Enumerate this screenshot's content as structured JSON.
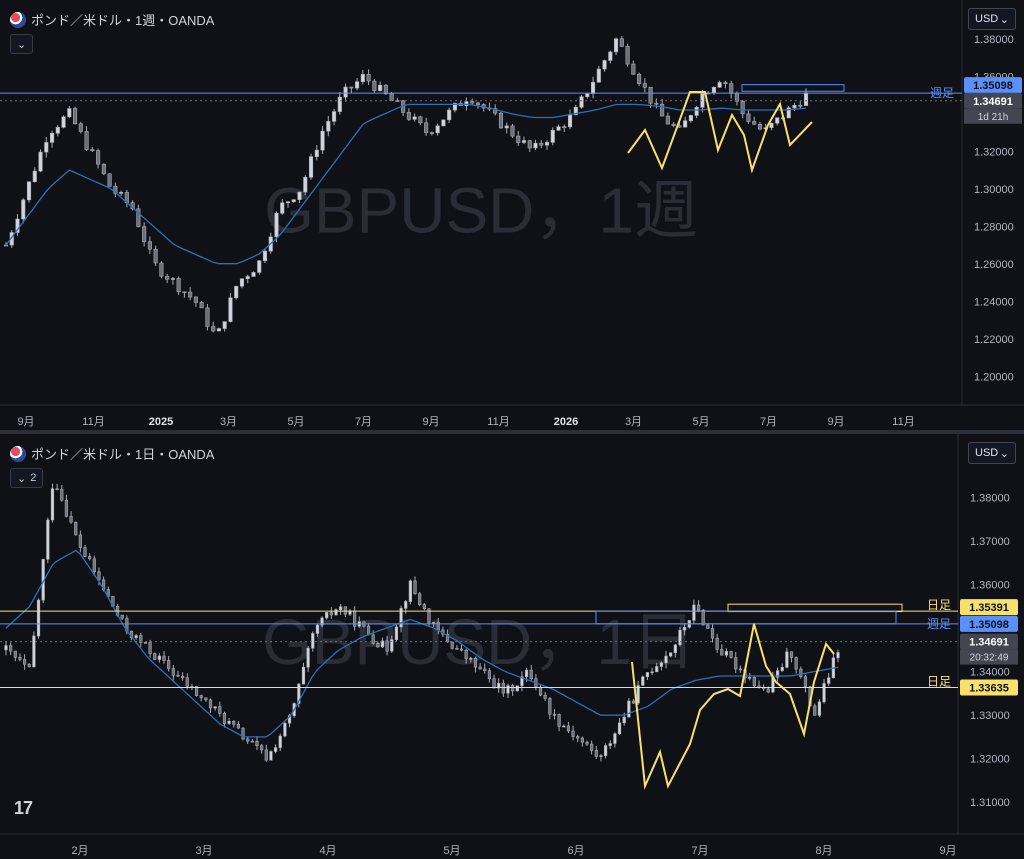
{
  "weekly": {
    "title": "ポンド／米ドル・1週・OANDA",
    "currency": "USD",
    "watermark": "GBPUSD，1週",
    "collapse_label": "",
    "yticks": [
      "1.38000",
      "1.36000",
      "1.34000",
      "1.32000",
      "1.30000",
      "1.28000",
      "1.26000",
      "1.24000",
      "1.22000",
      "1.20000"
    ],
    "xticks": [
      "9月",
      "11月",
      "2025",
      "3月",
      "5月",
      "7月",
      "9月",
      "11月",
      "2026",
      "3月",
      "5月",
      "7月",
      "9月",
      "11月"
    ],
    "level_label": "週足",
    "level_price": "1.35098",
    "last_price": "1.34691",
    "countdown": "1d 21h",
    "colors": {
      "up": "#d1d4dc",
      "down": "#d1d4dc",
      "ma": "#2f6fb3",
      "line": "#5b8ff9",
      "zigzag": "#f7e16b"
    }
  },
  "daily": {
    "title": "ポンド／米ドル・1日・OANDA",
    "currency": "USD",
    "watermark": "GBPUSD，1日",
    "collapse_label": "2",
    "yticks": [
      "1.38000",
      "1.37000",
      "1.36000",
      "1.35000",
      "1.34000",
      "1.33000",
      "1.32000",
      "1.31000"
    ],
    "xticks": [
      "2月",
      "3月",
      "4月",
      "5月",
      "6月",
      "7月",
      "8月",
      "9月"
    ],
    "levels": [
      {
        "label": "日足",
        "price": "1.35391",
        "color": "#f7e16b"
      },
      {
        "label": "週足",
        "price": "1.35098",
        "color": "#5b8ff9"
      },
      {
        "label": "日足",
        "price": "1.33635",
        "color": "#f7e16b"
      }
    ],
    "last_price": "1.34691",
    "countdown": "20:32:49"
  },
  "logo": "17",
  "chart_data": [
    {
      "type": "candlestick",
      "title": "ポンド／米ドル・1週・OANDA",
      "ylim": [
        1.19,
        1.39
      ],
      "x_ticks": [
        "9月",
        "11月",
        "2025",
        "3月",
        "5月",
        "7月",
        "9月",
        "11月",
        "2026",
        "3月",
        "5月",
        "7月",
        "9月",
        "11月"
      ],
      "close_path": [
        1.27,
        1.3,
        1.33,
        1.34,
        1.32,
        1.3,
        1.29,
        1.26,
        1.25,
        1.24,
        1.22,
        1.25,
        1.26,
        1.29,
        1.3,
        1.33,
        1.35,
        1.36,
        1.35,
        1.34,
        1.33,
        1.34,
        1.35,
        1.34,
        1.33,
        1.32,
        1.33,
        1.34,
        1.36,
        1.38,
        1.36,
        1.34,
        1.33,
        1.35,
        1.36,
        1.34,
        1.33,
        1.34,
        1.35
      ],
      "ma_path": [
        1.27,
        1.285,
        1.3,
        1.31,
        1.305,
        1.3,
        1.29,
        1.28,
        1.27,
        1.265,
        1.26,
        1.26,
        1.265,
        1.275,
        1.29,
        1.305,
        1.32,
        1.335,
        1.34,
        1.345,
        1.345,
        1.345,
        1.345,
        1.343,
        1.34,
        1.338,
        1.338,
        1.34,
        1.342,
        1.345,
        1.345,
        1.344,
        1.342,
        1.342,
        1.343,
        1.342,
        1.342,
        1.342,
        1.343
      ],
      "horizontal_lines": [
        {
          "label": "週足",
          "value": 1.35098
        }
      ],
      "last": 1.34691
    },
    {
      "type": "candlestick",
      "title": "ポンド／米ドル・1日・OANDA",
      "ylim": [
        1.305,
        1.39
      ],
      "x_ticks": [
        "2月",
        "3月",
        "4月",
        "5月",
        "6月",
        "7月",
        "8月",
        "9月"
      ],
      "close_path": [
        1.345,
        1.34,
        1.385,
        1.37,
        1.36,
        1.35,
        1.345,
        1.34,
        1.335,
        1.33,
        1.325,
        1.32,
        1.33,
        1.35,
        1.355,
        1.35,
        1.345,
        1.36,
        1.35,
        1.345,
        1.34,
        1.335,
        1.34,
        1.33,
        1.325,
        1.32,
        1.33,
        1.34,
        1.345,
        1.355,
        1.345,
        1.34,
        1.335,
        1.345,
        1.33,
        1.345
      ],
      "ma_path": [
        1.35,
        1.355,
        1.365,
        1.368,
        1.36,
        1.35,
        1.343,
        1.338,
        1.333,
        1.328,
        1.325,
        1.325,
        1.33,
        1.34,
        1.345,
        1.348,
        1.35,
        1.352,
        1.35,
        1.347,
        1.343,
        1.34,
        1.338,
        1.336,
        1.333,
        1.33,
        1.33,
        1.332,
        1.336,
        1.338,
        1.339,
        1.339,
        1.339,
        1.339,
        1.34,
        1.341
      ],
      "horizontal_lines": [
        {
          "label": "日足",
          "value": 1.35391
        },
        {
          "label": "週足",
          "value": 1.35098
        },
        {
          "label": "日足",
          "value": 1.33635
        }
      ],
      "last": 1.34691
    }
  ]
}
